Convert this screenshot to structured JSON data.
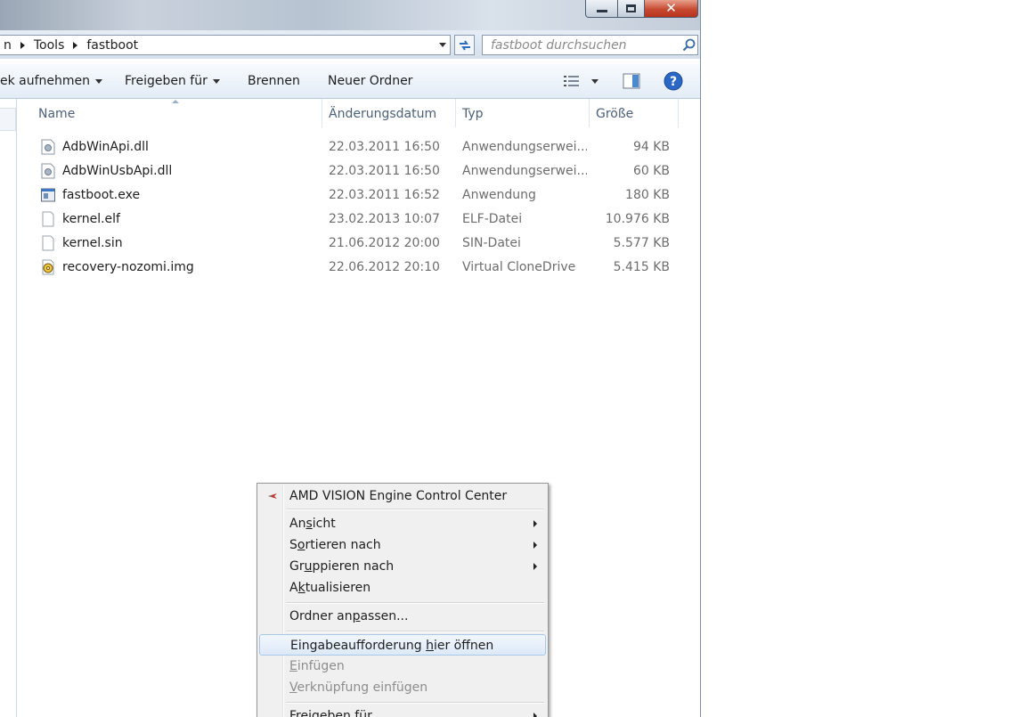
{
  "window": {
    "caption": {
      "minimize": "minimize",
      "maximize": "maximize",
      "close": "✕"
    }
  },
  "address": {
    "crumbs": [
      "n",
      "Tools",
      "fastboot"
    ],
    "search_placeholder": "fastboot durchsuchen"
  },
  "toolbar": {
    "items": [
      {
        "label": "ek aufnehmen",
        "has_dropdown": true
      },
      {
        "label": "Freigeben für",
        "has_dropdown": true
      },
      {
        "label": "Brennen",
        "has_dropdown": false
      },
      {
        "label": "Neuer Ordner",
        "has_dropdown": false
      }
    ],
    "icons": [
      "view-details-icon",
      "preview-pane-icon",
      "help-icon"
    ]
  },
  "columns": {
    "name": "Name",
    "date": "Änderungsdatum",
    "type": "Typ",
    "size": "Größe"
  },
  "files": [
    {
      "name": "AdbWinApi.dll",
      "date": "22.03.2011 16:50",
      "type": "Anwendungserwei...",
      "size": "94 KB",
      "icon": "dll-icon"
    },
    {
      "name": "AdbWinUsbApi.dll",
      "date": "22.03.2011 16:50",
      "type": "Anwendungserwei...",
      "size": "60 KB",
      "icon": "dll-icon"
    },
    {
      "name": "fastboot.exe",
      "date": "22.03.2011 16:52",
      "type": "Anwendung",
      "size": "180 KB",
      "icon": "exe-icon"
    },
    {
      "name": "kernel.elf",
      "date": "23.02.2013 10:07",
      "type": "ELF-Datei",
      "size": "10.976 KB",
      "icon": "file-icon"
    },
    {
      "name": "kernel.sin",
      "date": "21.06.2012 20:00",
      "type": "SIN-Datei",
      "size": "5.577 KB",
      "icon": "file-icon"
    },
    {
      "name": "recovery-nozomi.img",
      "date": "22.06.2012 20:10",
      "type": "Virtual CloneDrive",
      "size": "5.415 KB",
      "icon": "disc-image-icon"
    }
  ],
  "context_menu": {
    "items": [
      {
        "pre": "AMD VISION Engine Control Center",
        "ul": "",
        "post": "",
        "submenu": false,
        "disabled": false,
        "icon": "amd-icon"
      },
      {
        "pre": "An",
        "ul": "s",
        "post": "icht",
        "submenu": true,
        "disabled": false
      },
      {
        "pre": "S",
        "ul": "o",
        "post": "rtieren nach",
        "submenu": true,
        "disabled": false
      },
      {
        "pre": "Gr",
        "ul": "u",
        "post": "ppieren nach",
        "submenu": true,
        "disabled": false
      },
      {
        "pre": "A",
        "ul": "k",
        "post": "tualisieren",
        "submenu": false,
        "disabled": false
      },
      {
        "pre": "Ordner an",
        "ul": "p",
        "post": "assen...",
        "submenu": false,
        "disabled": false
      },
      {
        "pre": "Eingabeaufforderung ",
        "ul": "h",
        "post": "ier öffnen",
        "submenu": false,
        "disabled": false,
        "highlighted": true
      },
      {
        "pre": "",
        "ul": "E",
        "post": "infügen",
        "submenu": false,
        "disabled": true
      },
      {
        "pre": "",
        "ul": "V",
        "post": "erknüpfung einfügen",
        "submenu": false,
        "disabled": true
      },
      {
        "pre": "Freigeben für",
        "ul": "",
        "post": "",
        "submenu": true,
        "disabled": false
      }
    ]
  }
}
